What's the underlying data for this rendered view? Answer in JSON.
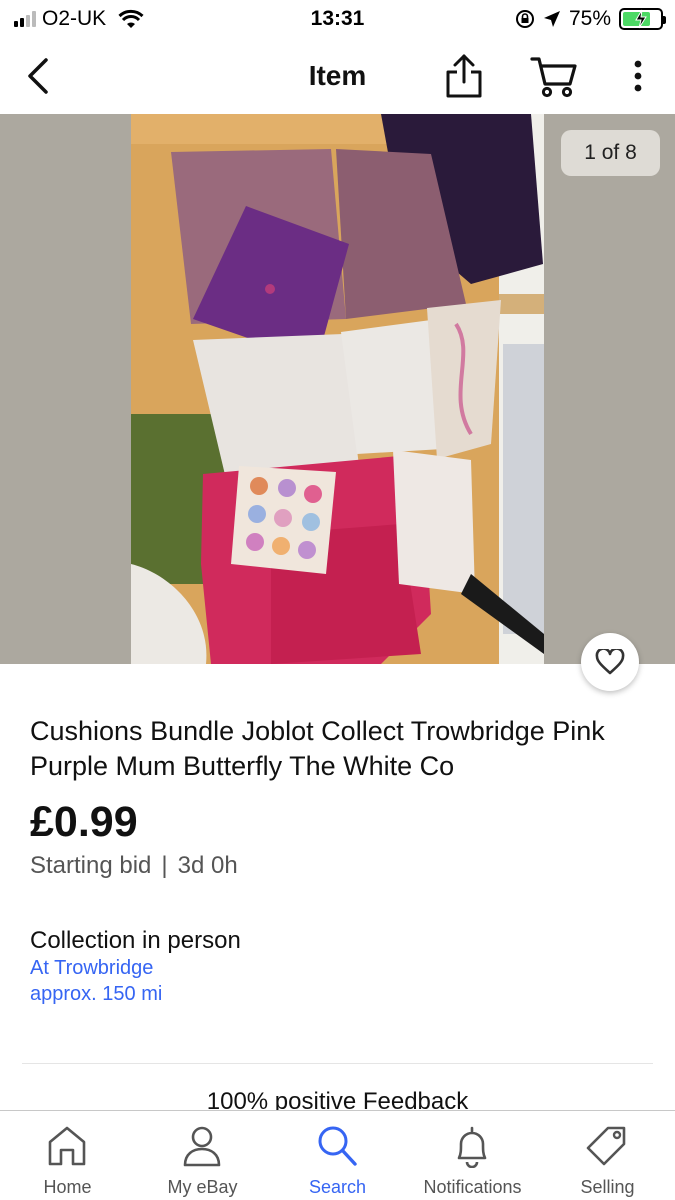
{
  "status_bar": {
    "carrier": "O2-UK",
    "time": "13:31",
    "battery": "75%",
    "battery_level": 0.75,
    "signal_bars": 2
  },
  "nav": {
    "title": "Item",
    "icons": [
      "chevron-left-icon",
      "share-icon",
      "cart-icon",
      "more-vertical-icon"
    ]
  },
  "gallery": {
    "counter": "1 of 8",
    "watch_icon": "heart-icon"
  },
  "item": {
    "title": "Cushions Bundle Joblot Collect Trowbridge Pink Purple Mum Butterfly The White Co",
    "price": "£0.99",
    "bid_type": "Starting bid",
    "separator": "|",
    "time_left": "3d 0h"
  },
  "delivery": {
    "heading": "Collection in person",
    "location": "At Trowbridge",
    "distance": "approx. 150 mi"
  },
  "seller": {
    "feedback": "100% positive Feedback"
  },
  "tab_bar": {
    "items": [
      {
        "label": "Home",
        "icon": "home-icon"
      },
      {
        "label": "My eBay",
        "icon": "person-icon"
      },
      {
        "label": "Search",
        "icon": "search-icon"
      },
      {
        "label": "Notifications",
        "icon": "bell-icon"
      },
      {
        "label": "Selling",
        "icon": "tag-icon"
      }
    ],
    "active": "Search"
  },
  "colors": {
    "link": "#3665f3",
    "photo_background": "#aca89f",
    "battery_fill": "#4cd964"
  }
}
